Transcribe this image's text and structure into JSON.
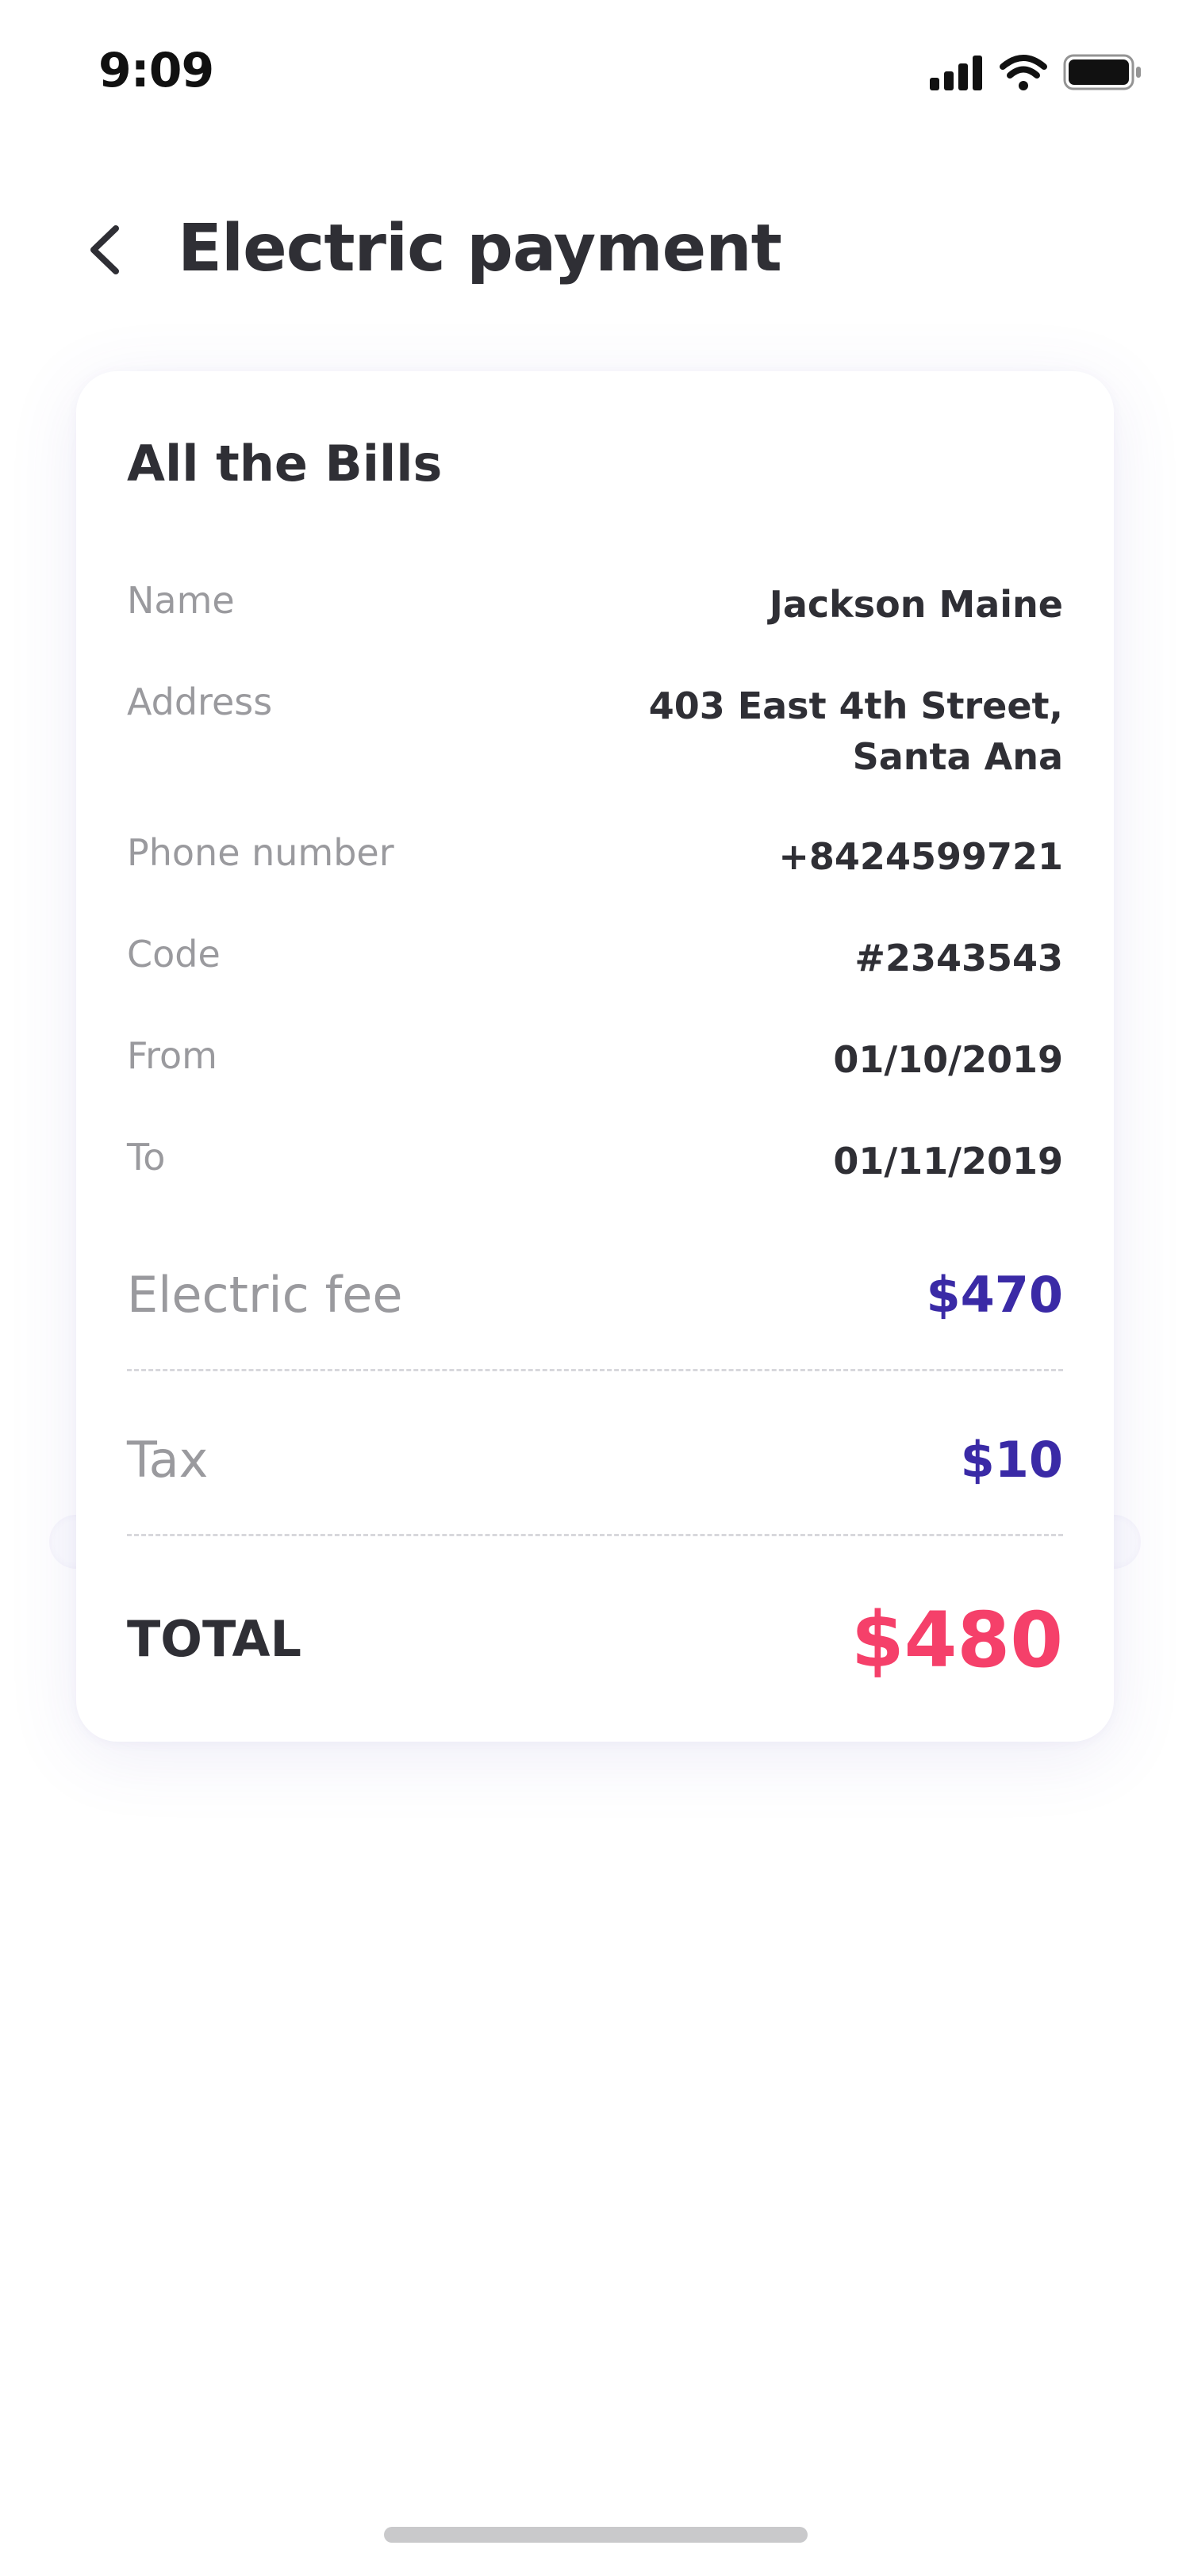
{
  "status_bar": {
    "time": "9:09",
    "icons": [
      "signal-icon",
      "wifi-icon",
      "battery-icon"
    ]
  },
  "header": {
    "back_icon": "chevron-left-icon",
    "title": "Electric payment"
  },
  "card": {
    "title": "All the Bills",
    "details": [
      {
        "label": "Name",
        "value": "Jackson Maine"
      },
      {
        "label": "Address",
        "value_line1": "403 East 4th Street,",
        "value_line2": "Santa Ana"
      },
      {
        "label": "Phone number",
        "value": "+8424599721"
      },
      {
        "label": "Code",
        "value": "#2343543"
      },
      {
        "label": "From",
        "value": "01/10/2019"
      },
      {
        "label": "To",
        "value": "01/11/2019"
      }
    ],
    "fees": [
      {
        "label": "Electric fee",
        "value": "$470"
      },
      {
        "label": "Tax",
        "value": "$10"
      }
    ],
    "total": {
      "label": "TOTAL",
      "value": "$480"
    }
  },
  "colors": {
    "accent": "#3a2aa6",
    "total": "#f5406a",
    "text": "#2f2f35",
    "muted": "#9a9a9e"
  }
}
